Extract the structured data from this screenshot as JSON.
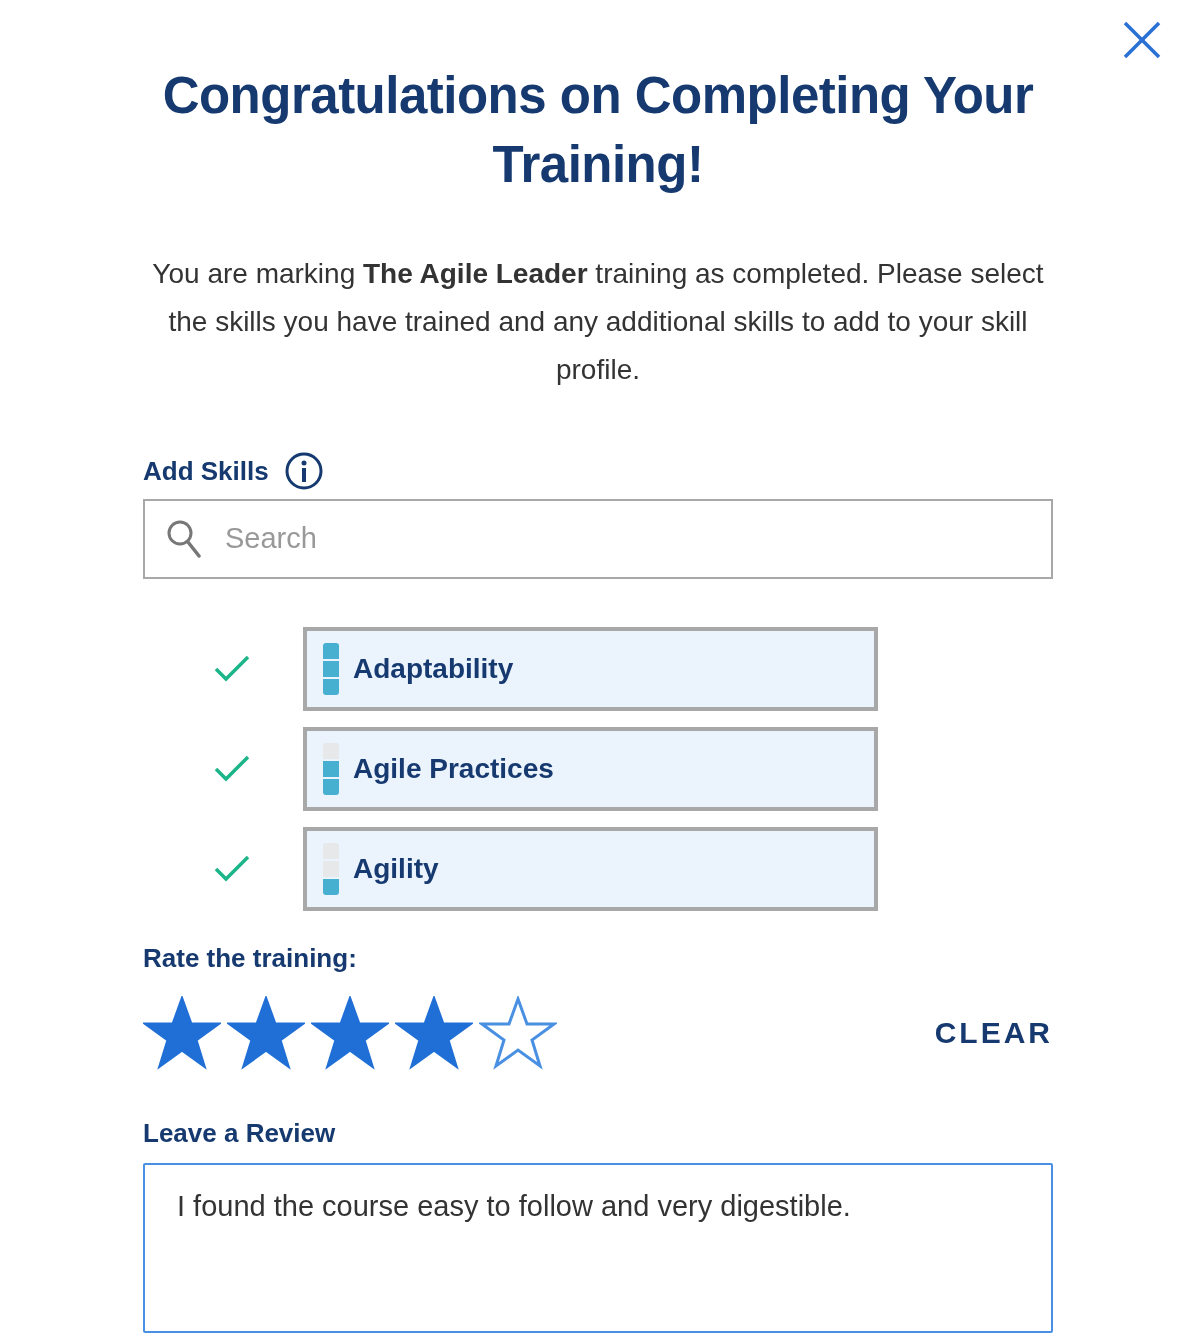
{
  "title": "Congratulations on Completing Your Training!",
  "intro": "You are marking **The Agile Leader** training as completed. Please select the skills you have trained and any additional skills to add to your skill profile.",
  "add_skills": {
    "label": "Add Skills",
    "search": {
      "placeholder": "Search"
    }
  },
  "skills": [
    {
      "name": "Adaptability",
      "checked": true,
      "level": 1
    },
    {
      "name": "Agile Practices",
      "checked": true,
      "level": 0.667
    },
    {
      "name": "Agility",
      "checked": true,
      "level": 0.333
    }
  ],
  "rating": {
    "label": "Rate the training:",
    "stars": 4,
    "clear_label": "CLEAR"
  },
  "review": {
    "label": "Leave a Review",
    "value": "I found the course easy to follow and very digestible."
  }
}
